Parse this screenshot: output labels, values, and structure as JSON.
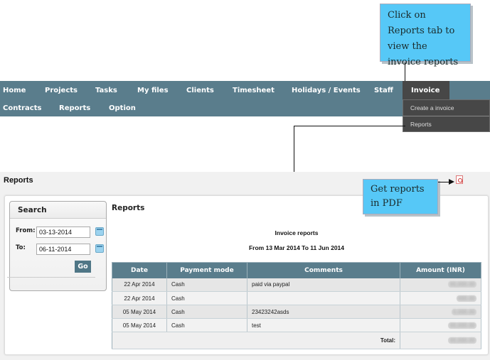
{
  "nav": {
    "row1": [
      {
        "label": "Home"
      },
      {
        "label": "Projects"
      },
      {
        "label": "Tasks"
      },
      {
        "label": "My files"
      },
      {
        "label": "Clients"
      },
      {
        "label": "Timesheet"
      },
      {
        "label": "Holidays / Events"
      },
      {
        "label": "Staff"
      }
    ],
    "active": "Invoice",
    "row2": [
      {
        "label": "Contracts"
      },
      {
        "label": "Reports"
      },
      {
        "label": "Option"
      }
    ],
    "dropdown": [
      {
        "label": "Create a invoice"
      },
      {
        "label": "Reports"
      }
    ]
  },
  "callouts": {
    "reports_tab": "Click on Reports tab to view the invoice reports",
    "pdf": "Get reports in PDF"
  },
  "page": {
    "title": "Reports",
    "pdf_icon": "pdf-icon"
  },
  "search": {
    "title": "Search",
    "from_label": "From:",
    "from_value": "03-13-2014",
    "to_label": "To:",
    "to_value": "06-11-2014",
    "go_label": "Go"
  },
  "report": {
    "title": "Reports",
    "heading": "Invoice reports",
    "range": "From 13 Mar 2014 To 11 Jun 2014",
    "columns": [
      "Date",
      "Payment mode",
      "Comments",
      "Amount (INR)"
    ],
    "rows": [
      {
        "date": "22 Apr 2014",
        "mode": "Cash",
        "comment": "paid via paypal",
        "amount": "[redacted]"
      },
      {
        "date": "22 Apr 2014",
        "mode": "Cash",
        "comment": "",
        "amount": "[redacted]"
      },
      {
        "date": "05 May 2014",
        "mode": "Cash",
        "comment": "23423242asds",
        "amount": "[redacted]"
      },
      {
        "date": "05 May 2014",
        "mode": "Cash",
        "comment": "test",
        "amount": "[redacted]"
      }
    ],
    "total_label": "Total:",
    "total_value": "[redacted]"
  }
}
